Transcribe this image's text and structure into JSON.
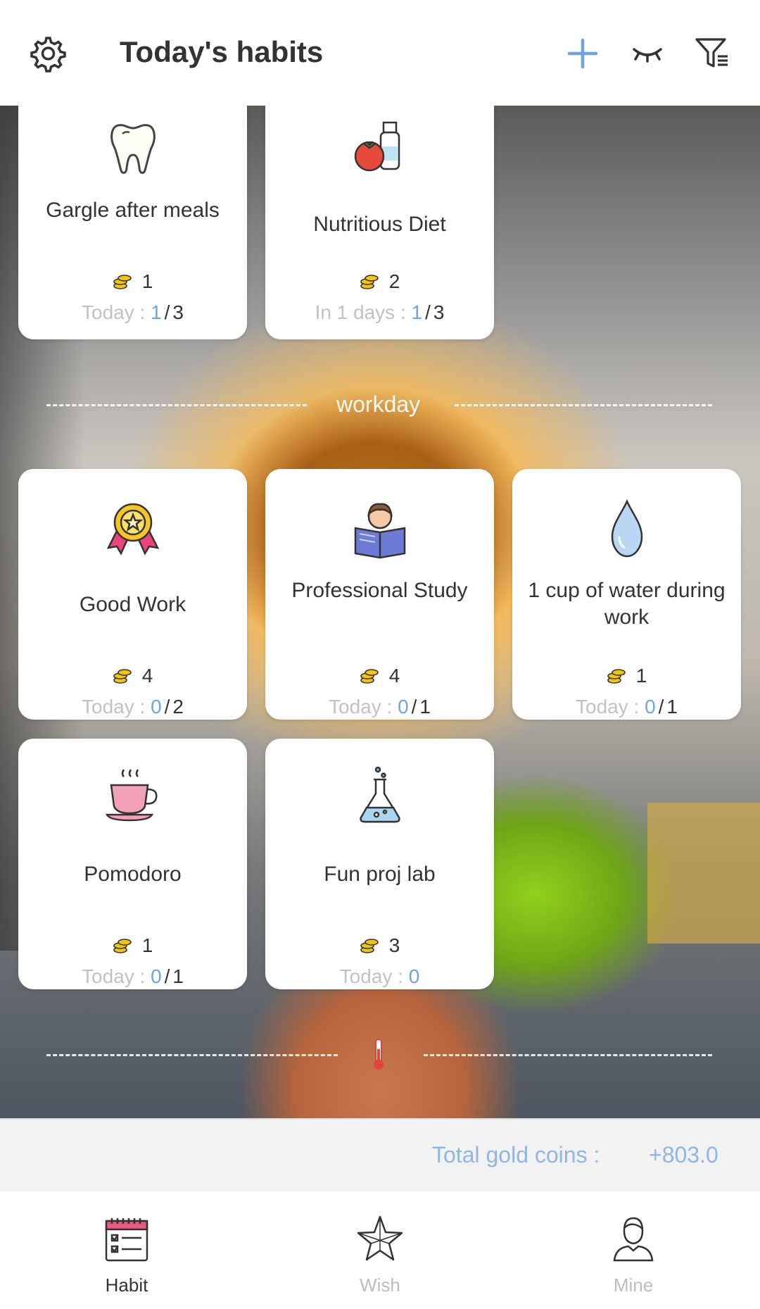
{
  "header": {
    "title": "Today's habits",
    "icons": [
      "gear-icon",
      "plus-icon",
      "eye-closed-icon",
      "filter-icon"
    ],
    "accent": "#6fa3e6"
  },
  "cards": [
    {
      "name": "Gargle after meals",
      "icon": "tooth-icon",
      "coins": "1",
      "progress_label": "Today :",
      "done": "1",
      "total": "3"
    },
    {
      "name": "Nutritious Diet",
      "icon": "tomato-milk-icon",
      "coins": "2",
      "progress_label": "In 1 days :",
      "done": "1",
      "total": "3"
    },
    {
      "name": "Good Work",
      "icon": "medal-icon",
      "coins": "4",
      "progress_label": "Today :",
      "done": "0",
      "total": "2"
    },
    {
      "name": "Professional Study",
      "icon": "reading-person-icon",
      "coins": "4",
      "progress_label": "Today :",
      "done": "0",
      "total": "1"
    },
    {
      "name": "1 cup of water during work",
      "icon": "water-drop-icon",
      "coins": "1",
      "progress_label": "Today :",
      "done": "0",
      "total": "1"
    },
    {
      "name": "Pomodoro",
      "icon": "tea-cup-icon",
      "coins": "1",
      "progress_label": "Today :",
      "done": "0",
      "total": "1"
    },
    {
      "name": "Fun proj lab",
      "icon": "flask-icon",
      "coins": "3",
      "progress_label": "Today :",
      "done": "0",
      "total": ""
    }
  ],
  "groups": {
    "workday_label": "workday",
    "temperature_icon": "thermometer-icon"
  },
  "summary": {
    "label": "Total gold coins :",
    "value": "+803.0"
  },
  "nav": {
    "items": [
      {
        "label": "Habit",
        "icon": "calendar-checklist-icon",
        "active": true
      },
      {
        "label": "Wish",
        "icon": "star-icon",
        "active": false
      },
      {
        "label": "Mine",
        "icon": "person-icon",
        "active": false
      }
    ]
  }
}
